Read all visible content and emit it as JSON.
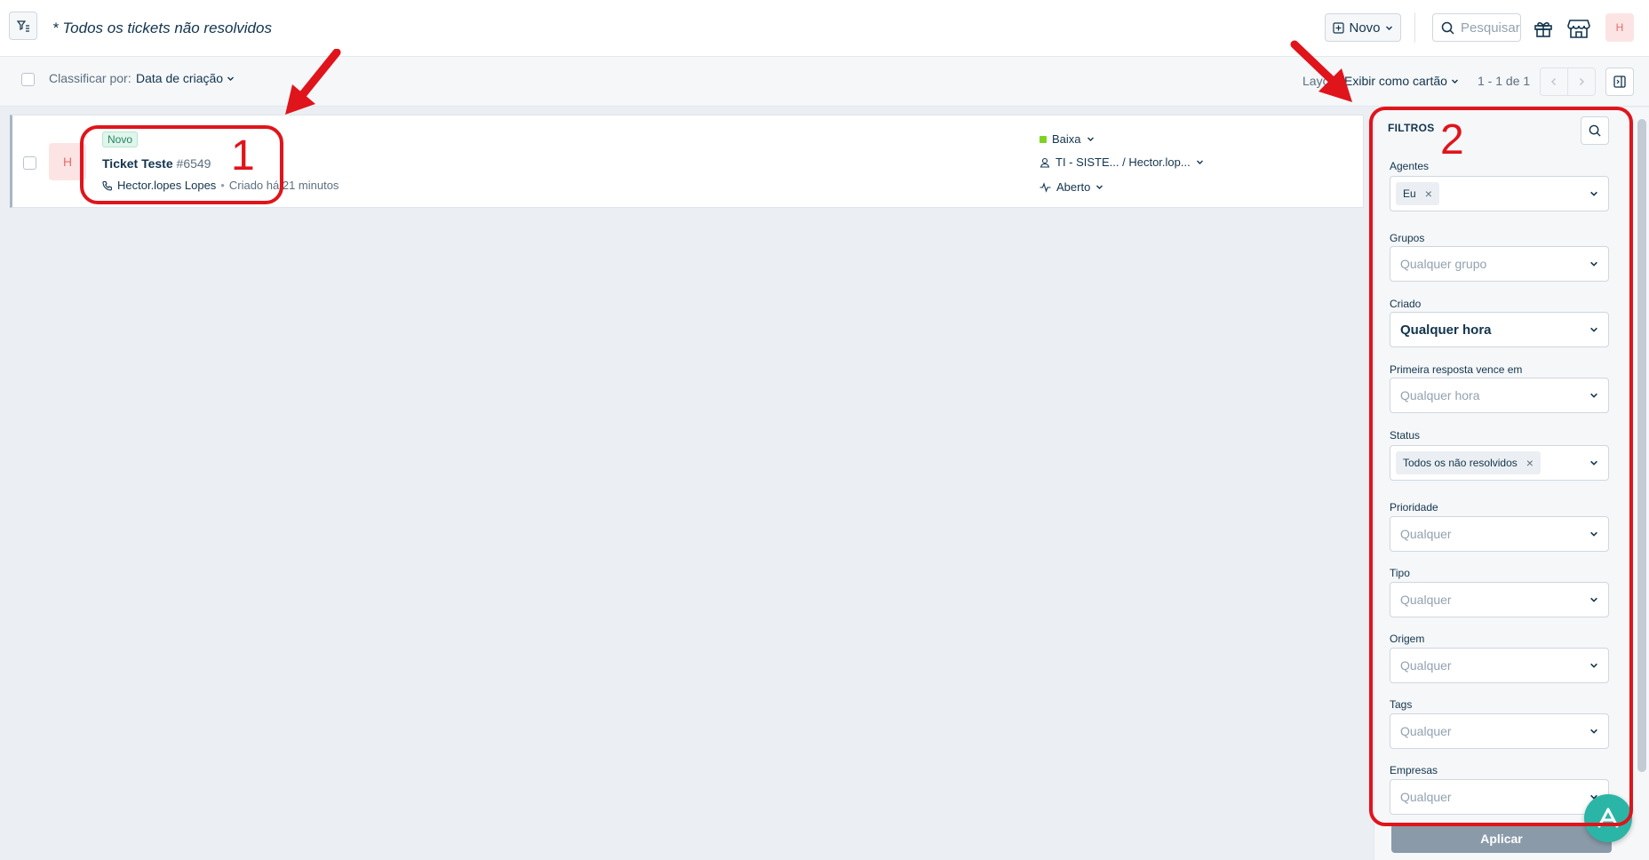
{
  "header": {
    "title": "* Todos os tickets não resolvidos",
    "new_button": "Novo",
    "search_placeholder": "Pesquisar",
    "avatar_initial": "H"
  },
  "toolbar": {
    "sort_label": "Classificar por:",
    "sort_value": "Data de criação",
    "layout_label": "Layo",
    "layout_value": "Exibir como cartão",
    "pagination": "1 - 1 de 1"
  },
  "ticket": {
    "avatar_initial": "H",
    "badge": "Novo",
    "subject": "Ticket Teste",
    "number": "#6549",
    "requester": "Hector.lopes Lopes",
    "separator": "•",
    "created": "Criado há 21 minutos",
    "priority": "Baixa",
    "assignment": "TI - SISTE... / Hector.lop...",
    "status": "Aberto",
    "priority_color": "#7ed321"
  },
  "filters": {
    "title": "FILTROS",
    "fields": [
      {
        "label": "Agentes",
        "chip": "Eu"
      },
      {
        "label": "Grupos",
        "placeholder": "Qualquer grupo"
      },
      {
        "label": "Criado",
        "value": "Qualquer hora"
      },
      {
        "label": "Primeira resposta vence em",
        "placeholder": "Qualquer hora"
      },
      {
        "label": "Status",
        "chip": "Todos os não resolvidos"
      },
      {
        "label": "Prioridade",
        "placeholder": "Qualquer"
      },
      {
        "label": "Tipo",
        "placeholder": "Qualquer"
      },
      {
        "label": "Origem",
        "placeholder": "Qualquer"
      },
      {
        "label": "Tags",
        "placeholder": "Qualquer"
      },
      {
        "label": "Empresas",
        "placeholder": "Qualquer"
      }
    ],
    "apply": "Aplicar"
  },
  "annotations": {
    "one": "1",
    "two": "2",
    "color": "#e0141b"
  }
}
